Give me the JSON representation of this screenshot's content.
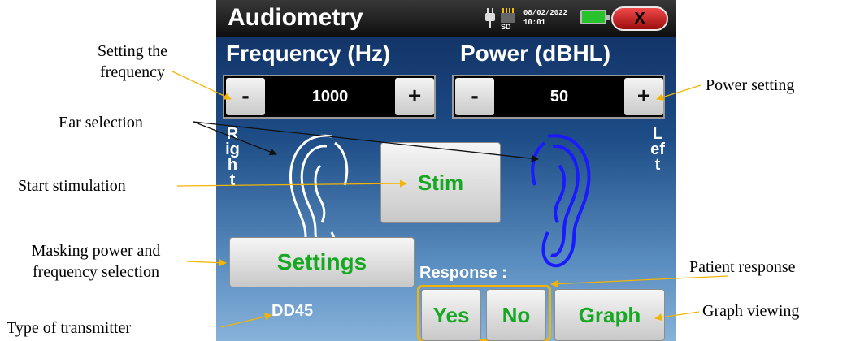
{
  "screen": {
    "title": "Audiometry",
    "sd_label": "SD",
    "date": "08/02/2022",
    "time": "10:01",
    "close_label": "X",
    "frequency": {
      "header": "Frequency (Hz)",
      "minus": "-",
      "plus": "+",
      "value": "1000"
    },
    "power": {
      "header": "Power (dBHL)",
      "minus": "-",
      "plus": "+",
      "value": "50"
    },
    "right_label": "Right",
    "left_label": "Left",
    "stim_label": "Stim",
    "settings_label": "Settings",
    "response_label": "Response :",
    "yes_label": "Yes",
    "no_label": "No",
    "graph_label": "Graph",
    "transducer": "DD45",
    "colors": {
      "right_ear": "#ffffff",
      "left_ear": "#1a1aff",
      "button_text": "#17a821",
      "highlight": "#f4b400"
    },
    "icons": [
      "plug-icon",
      "sd-card-icon",
      "battery-icon",
      "close-icon",
      "ear-icon"
    ]
  },
  "callouts": {
    "setting_frequency": "Setting the frequency",
    "ear_selection": "Ear selection",
    "start_stimulation": "Start stimulation",
    "masking": "Masking power and frequency selection",
    "type_transmitter": "Type of transmitter",
    "power_setting": "Power setting",
    "patient_response": "Patient response",
    "graph_viewing": "Graph viewing"
  }
}
